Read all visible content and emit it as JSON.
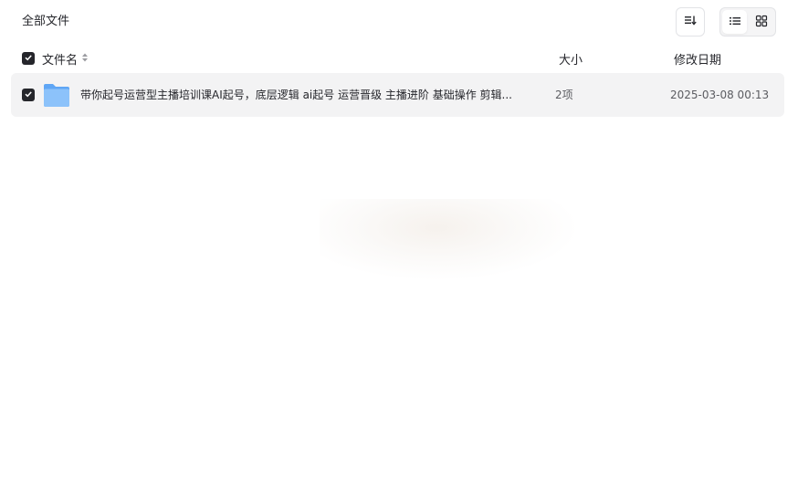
{
  "breadcrumb": {
    "current": "全部文件"
  },
  "toolbar": {
    "sort_icon": "sort-icon",
    "view_list_icon": "list-view-icon",
    "view_grid_icon": "grid-view-icon",
    "active_view": "list"
  },
  "table": {
    "columns": {
      "name": "文件名",
      "size": "大小",
      "date": "修改日期"
    },
    "rows": [
      {
        "icon": "folder-icon",
        "name": "带你起号运营型主播培训课AI起号，底层逻辑 ai起号 运营晋级 主播进阶 基础操作 剪辑...",
        "size": "2项",
        "date": "2025-03-08 00:13",
        "checked": true
      }
    ]
  },
  "colors": {
    "text": "#25262b",
    "row_bg": "#f3f3f4",
    "folder": "#6aaef6",
    "checkbox": "#25262b"
  }
}
